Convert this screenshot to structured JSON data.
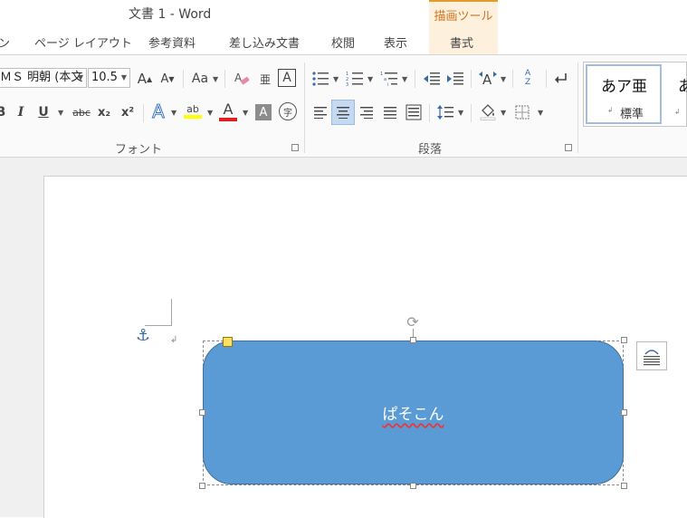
{
  "window": {
    "title": "文書 1 - Word",
    "context_tab_group": "描画ツール"
  },
  "tabs": [
    {
      "label": "ン"
    },
    {
      "label": "ページ レイアウト"
    },
    {
      "label": "参考資料"
    },
    {
      "label": "差し込み文書"
    },
    {
      "label": "校閲"
    },
    {
      "label": "表示"
    },
    {
      "label": "書式"
    }
  ],
  "ribbon": {
    "font_group": {
      "label": "フォント",
      "font_name": "ＭＳ 明朝 (本文",
      "font_size": "10.5",
      "grow_icon": "A",
      "shrink_icon": "A",
      "case_label": "Aa",
      "phonetic_label": "亜",
      "border_char_label": "A",
      "bold": "B",
      "italic": "I",
      "underline": "U",
      "strike": "abc",
      "subscript": "x₂",
      "superscript": "x²",
      "effects_label": "A",
      "highlight_label": "ab",
      "font_color_label": "A",
      "shading_label": "A",
      "enclose_label": "字",
      "highlight_color": "#ffff00",
      "font_color": "#e02020"
    },
    "paragraph_group": {
      "label": "段落",
      "sort_label": "A Z"
    },
    "styles": {
      "normal_sample": "あア亜",
      "normal_name": "標準",
      "next_sample": "あ"
    }
  },
  "document": {
    "shape_text": "ぱそこん",
    "shape_fill": "#5b9bd5",
    "shape_border": "#41719c",
    "anchor_icon": "anchor-icon"
  }
}
